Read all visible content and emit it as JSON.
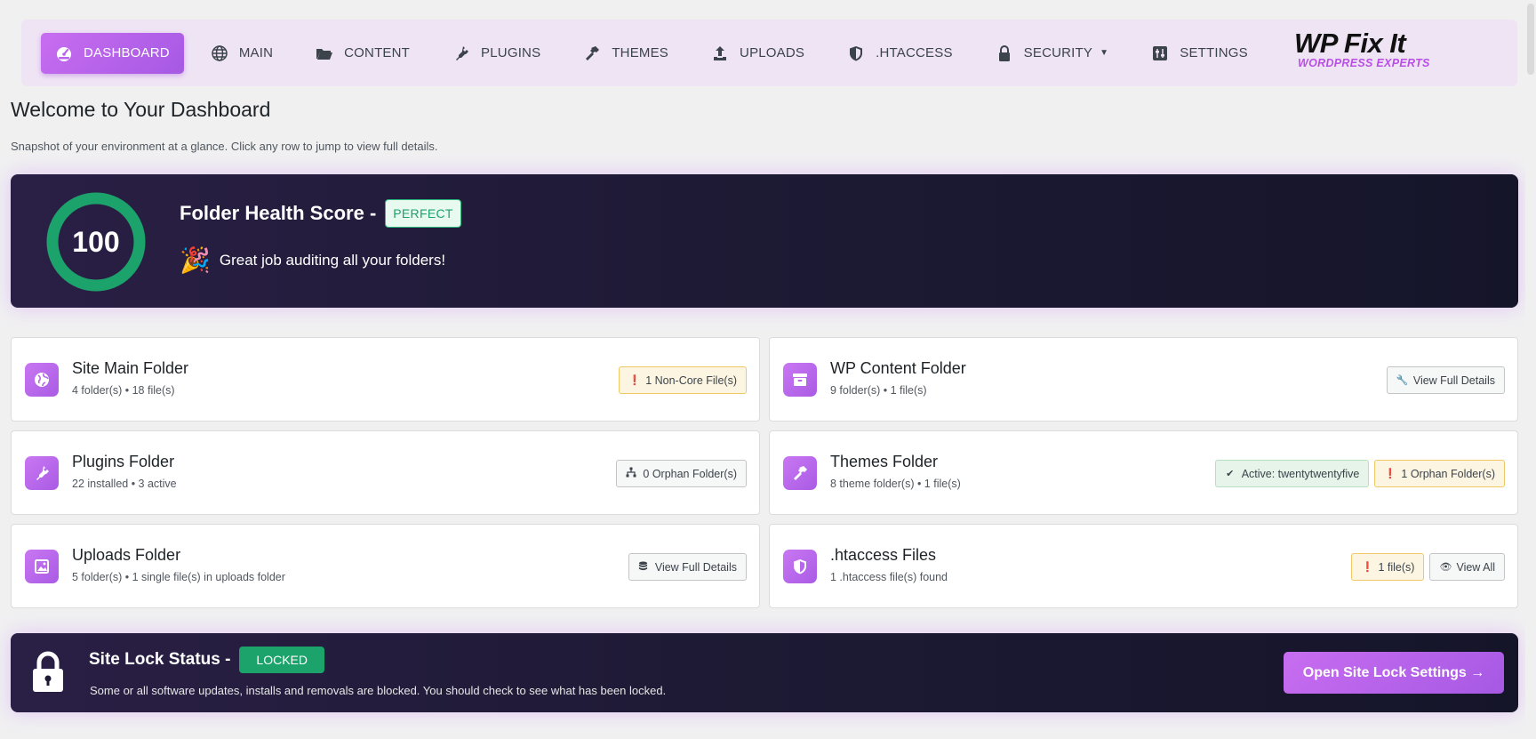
{
  "nav": {
    "items": [
      {
        "label": "DASHBOARD",
        "icon": "gauge-icon",
        "active": true
      },
      {
        "label": "MAIN",
        "icon": "globe-icon"
      },
      {
        "label": "CONTENT",
        "icon": "folder-open-icon"
      },
      {
        "label": "PLUGINS",
        "icon": "plug-icon"
      },
      {
        "label": "THEMES",
        "icon": "hammer-icon"
      },
      {
        "label": "UPLOADS",
        "icon": "upload-icon"
      },
      {
        "label": ".HTACCESS",
        "icon": "shield-icon"
      },
      {
        "label": "SECURITY",
        "icon": "lock-icon",
        "dropdown": true
      },
      {
        "label": "SETTINGS",
        "icon": "sliders-icon"
      }
    ],
    "logo": {
      "main": "WP Fix It",
      "sub": "WORDPRESS EXPERTS"
    }
  },
  "page": {
    "title": "Welcome to Your Dashboard",
    "subtitle": "Snapshot of your environment at a glance. Click any row to jump to view full details."
  },
  "health": {
    "score": "100",
    "score_fraction": 1.0,
    "title": "Folder Health Score -",
    "badge": "PERFECT",
    "message": "Great job auditing all your folders!",
    "colors": {
      "ring": "#1ba36b",
      "banner": "#1e1a35"
    }
  },
  "cards": {
    "main": {
      "title": "Site Main Folder",
      "sub": "4 folder(s) • 18 file(s)",
      "icon": "globe-icon",
      "actions": [
        {
          "label": "1 Non-Core File(s)",
          "icon": "exclamation-icon",
          "style": "warn"
        }
      ]
    },
    "content": {
      "title": "WP Content Folder",
      "sub": "9 folder(s) • 1 file(s)",
      "icon": "archive-icon",
      "actions": [
        {
          "label": "View Full Details",
          "icon": "wrench-icon",
          "style": "neutral"
        }
      ]
    },
    "plugins": {
      "title": "Plugins Folder",
      "sub": "22 installed • 3 active",
      "icon": "plug-icon",
      "actions": [
        {
          "label": "0 Orphan Folder(s)",
          "icon": "sitemap-icon",
          "style": "neutral"
        }
      ]
    },
    "themes": {
      "title": "Themes Folder",
      "sub": "8 theme folder(s) • 1 file(s)",
      "icon": "hammer-icon",
      "actions": [
        {
          "label": "Active: twentytwentyfive",
          "icon": "check-icon",
          "style": "ok"
        },
        {
          "label": "1 Orphan Folder(s)",
          "icon": "exclamation-icon",
          "style": "warn"
        }
      ]
    },
    "uploads": {
      "title": "Uploads Folder",
      "sub": "5 folder(s) • 1 single file(s) in uploads folder",
      "icon": "image-icon",
      "actions": [
        {
          "label": "View Full Details",
          "icon": "database-icon",
          "style": "neutral"
        }
      ]
    },
    "htaccess": {
      "title": ".htaccess Files",
      "sub": "1 .htaccess file(s) found",
      "icon": "shield-icon",
      "actions": [
        {
          "label": "1 file(s)",
          "icon": "exclamation-icon",
          "style": "warn"
        },
        {
          "label": "View All",
          "icon": "eye-icon",
          "style": "neutral"
        }
      ]
    }
  },
  "lock": {
    "title": "Site Lock Status -",
    "badge": "LOCKED",
    "message": "Some or all software updates, installs and removals are blocked. You should check to see what has been locked.",
    "button": "Open Site Lock Settings →"
  }
}
